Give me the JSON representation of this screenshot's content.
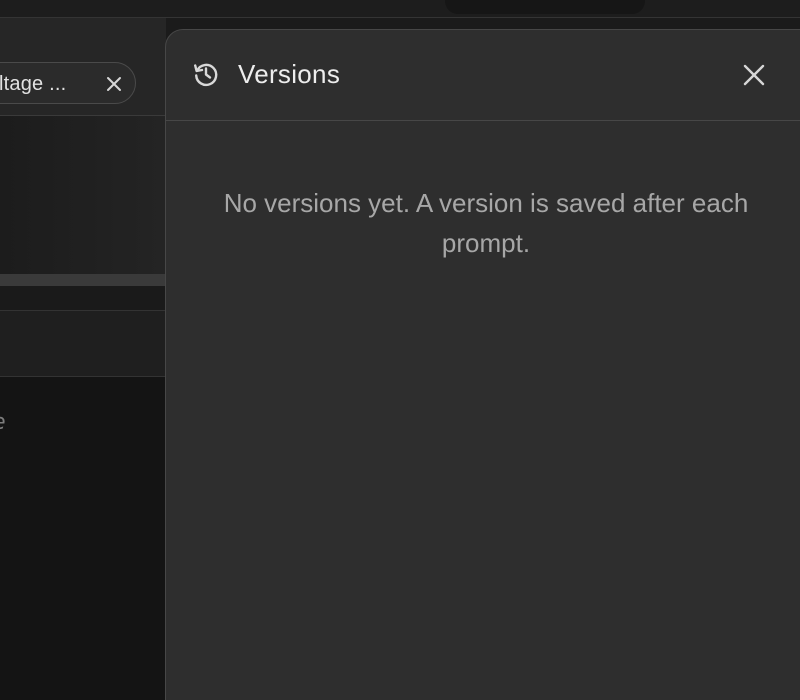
{
  "background": {
    "tab_label": "ltage ...",
    "editor_snippet": "ple"
  },
  "versions_panel": {
    "title": "Versions",
    "empty_message": "No versions yet. A version is saved after each prompt."
  },
  "icons": {
    "header": "history-icon",
    "close": "close-icon",
    "tab_close": "close-icon"
  },
  "colors": {
    "panel_bg": "#2e2e2e",
    "panel_border": "#474747",
    "title_text": "#ededed",
    "message_text": "#a7a7a7"
  }
}
